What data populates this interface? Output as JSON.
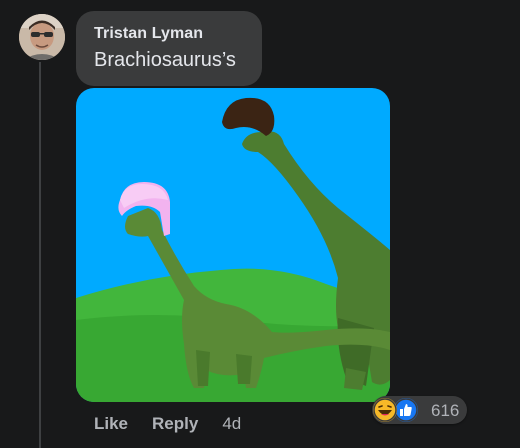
{
  "comment": {
    "author": "Tristan Lyman",
    "text": "Brachiosaurus’s"
  },
  "actions": {
    "like": "Like",
    "reply": "Reply",
    "timestamp": "4d"
  },
  "reactions": {
    "count": "616",
    "types": [
      "laughing-face-icon",
      "like-thumb-icon"
    ]
  },
  "colors": {
    "background": "#18191a",
    "bubble": "#3a3b3c",
    "text_primary": "#e4e6eb",
    "text_secondary": "#b0b3b8",
    "like_blue": "#1877f2",
    "haha_yellow": "#f7b928"
  }
}
